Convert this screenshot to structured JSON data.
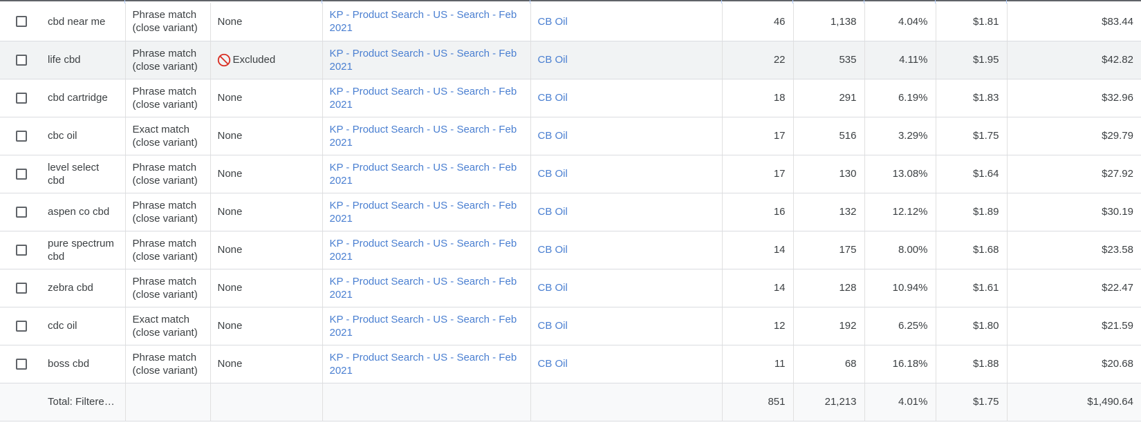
{
  "rows": [
    {
      "keyword": "cbd near me",
      "match_type": "Phrase match\n(close variant)",
      "status": "None",
      "status_icon": null,
      "campaign": "KP - Product Search - US - Search - Feb 2021",
      "ad_group": "CB Oil",
      "clicks": "46",
      "impressions": "1,138",
      "ctr": "4.04%",
      "avg_cpc": "$1.81",
      "cost": "$83.44"
    },
    {
      "keyword": "life cbd",
      "match_type": "Phrase match\n(close variant)",
      "status": "Excluded",
      "status_icon": "ban-icon",
      "campaign": "KP - Product Search - US - Search - Feb 2021",
      "ad_group": "CB Oil",
      "clicks": "22",
      "impressions": "535",
      "ctr": "4.11%",
      "avg_cpc": "$1.95",
      "cost": "$42.82"
    },
    {
      "keyword": "cbd cartridge",
      "match_type": "Phrase match\n(close variant)",
      "status": "None",
      "status_icon": null,
      "campaign": "KP - Product Search - US - Search - Feb 2021",
      "ad_group": "CB Oil",
      "clicks": "18",
      "impressions": "291",
      "ctr": "6.19%",
      "avg_cpc": "$1.83",
      "cost": "$32.96"
    },
    {
      "keyword": "cbc oil",
      "match_type": "Exact match\n(close variant)",
      "status": "None",
      "status_icon": null,
      "campaign": "KP - Product Search - US - Search - Feb 2021",
      "ad_group": "CB Oil",
      "clicks": "17",
      "impressions": "516",
      "ctr": "3.29%",
      "avg_cpc": "$1.75",
      "cost": "$29.79"
    },
    {
      "keyword": "level select cbd",
      "match_type": "Phrase match\n(close variant)",
      "status": "None",
      "status_icon": null,
      "campaign": "KP - Product Search - US - Search - Feb 2021",
      "ad_group": "CB Oil",
      "clicks": "17",
      "impressions": "130",
      "ctr": "13.08%",
      "avg_cpc": "$1.64",
      "cost": "$27.92"
    },
    {
      "keyword": "aspen co cbd",
      "match_type": "Phrase match\n(close variant)",
      "status": "None",
      "status_icon": null,
      "campaign": "KP - Product Search - US - Search - Feb 2021",
      "ad_group": "CB Oil",
      "clicks": "16",
      "impressions": "132",
      "ctr": "12.12%",
      "avg_cpc": "$1.89",
      "cost": "$30.19"
    },
    {
      "keyword": "pure spectrum cbd",
      "match_type": "Phrase match\n(close variant)",
      "status": "None",
      "status_icon": null,
      "campaign": "KP - Product Search - US - Search - Feb 2021",
      "ad_group": "CB Oil",
      "clicks": "14",
      "impressions": "175",
      "ctr": "8.00%",
      "avg_cpc": "$1.68",
      "cost": "$23.58"
    },
    {
      "keyword": "zebra cbd",
      "match_type": "Phrase match\n(close variant)",
      "status": "None",
      "status_icon": null,
      "campaign": "KP - Product Search - US - Search - Feb 2021",
      "ad_group": "CB Oil",
      "clicks": "14",
      "impressions": "128",
      "ctr": "10.94%",
      "avg_cpc": "$1.61",
      "cost": "$22.47"
    },
    {
      "keyword": "cdc oil",
      "match_type": "Exact match\n(close variant)",
      "status": "None",
      "status_icon": null,
      "campaign": "KP - Product Search - US - Search - Feb 2021",
      "ad_group": "CB Oil",
      "clicks": "12",
      "impressions": "192",
      "ctr": "6.25%",
      "avg_cpc": "$1.80",
      "cost": "$21.59"
    },
    {
      "keyword": "boss cbd",
      "match_type": "Phrase match\n(close variant)",
      "status": "None",
      "status_icon": null,
      "campaign": "KP - Product Search - US - Search - Feb 2021",
      "ad_group": "CB Oil",
      "clicks": "11",
      "impressions": "68",
      "ctr": "16.18%",
      "avg_cpc": "$1.88",
      "cost": "$20.68"
    }
  ],
  "total": {
    "label": "Total: Filtered ...",
    "clicks": "851",
    "impressions": "21,213",
    "ctr": "4.01%",
    "avg_cpc": "$1.75",
    "cost": "$1,490.64"
  },
  "colors": {
    "link": "#4a7fd1",
    "excluded_icon": "#d93025",
    "hover_row": "#f1f3f4",
    "total_row": "#f8f9fa"
  }
}
